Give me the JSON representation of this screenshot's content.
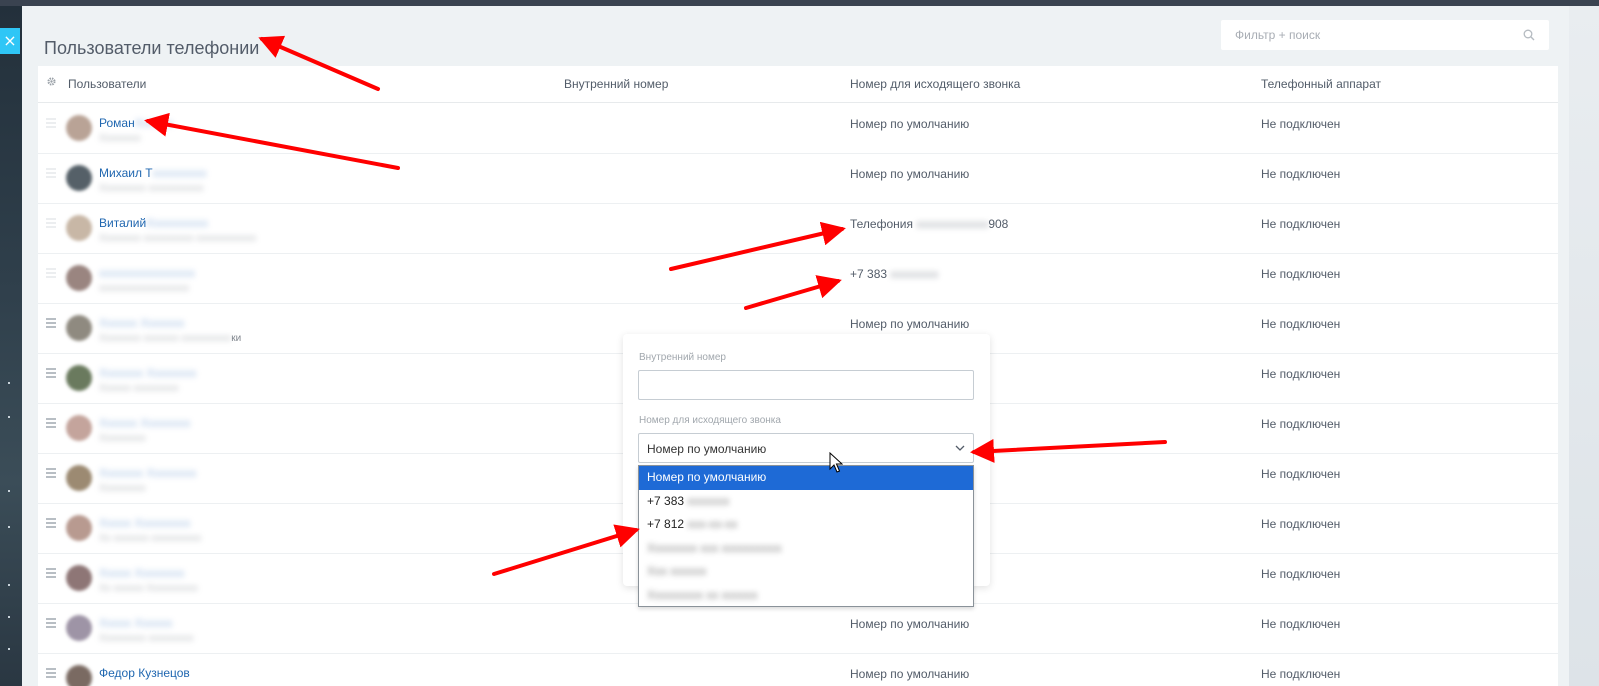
{
  "page": {
    "title": "Пользователи телефонии",
    "search_placeholder": "Фильтр + поиск",
    "close_symbol": "×"
  },
  "table": {
    "columns": [
      "Пользователи",
      "Внутренний номер",
      "Номер для исходящего звонка",
      "Телефонный аппарат"
    ],
    "rows": [
      {
        "name": "Роман",
        "name_blur": "Xxxxxx",
        "sub": "Xxxxxxxx",
        "outgoing": "Номер по умолчанию",
        "outgoing_blur": "",
        "outgoing_tail": "",
        "device": "Не подключен"
      },
      {
        "name": "Михаил Т",
        "name_blur": "xxxxxxxxx",
        "sub": "Xxxxxxxxx xxxxxxxxxxx",
        "outgoing": "Номер по умолчанию",
        "outgoing_blur": "",
        "outgoing_tail": "",
        "device": "Не подключен"
      },
      {
        "name": "Виталий",
        "name_blur": "Xxxxxxxxxx",
        "sub": "Xxxxxxxx xxxxxxxxxx xxxxxxxxxxxx",
        "outgoing": "Телефония",
        "outgoing_blur": "xxxxxxxxxxxx",
        "outgoing_tail": "908",
        "device": "Не подключен"
      },
      {
        "name": "",
        "name_blur": "xxxxxxxxxxxxxxxx",
        "sub": "xxxxxxxxxxxxxxxxxx",
        "outgoing": "+7 383",
        "outgoing_blur": "xxxxxxxx",
        "outgoing_tail": "",
        "device": "Не подключен"
      },
      {
        "name": "",
        "name_blur": "Xxxxxx Xxxxxxx",
        "sub": "Xxxxxxxx xxxxxxx xxxxxxxxxx",
        "sub_visible": "ки",
        "outgoing": "Номер по умолчанию",
        "outgoing_blur": "",
        "outgoing_tail": "",
        "device": "Не подключен"
      },
      {
        "name": "",
        "name_blur": "Xxxxxxx Xxxxxxxx",
        "sub": "Xxxxxx xxxxxxxxx",
        "outgoing": "",
        "outgoing_blur": "",
        "outgoing_tail": "",
        "device": "Не подключен"
      },
      {
        "name": "",
        "name_blur": "Xxxxxx Xxxxxxxx",
        "sub": "Xxxxxxxxx",
        "outgoing": "",
        "outgoing_blur": "",
        "outgoing_tail": "",
        "device": "Не подключен"
      },
      {
        "name": "",
        "name_blur": "Xxxxxxx Xxxxxxxx",
        "sub": "Xxxxxxxxx",
        "outgoing": "",
        "outgoing_blur": "",
        "outgoing_tail": "",
        "device": "Не подключен"
      },
      {
        "name": "",
        "name_blur": "Xxxxx Xxxxxxxxx",
        "sub": "Xx xxxxxxx xxxxxxxxxx",
        "outgoing": "",
        "outgoing_blur": "",
        "outgoing_tail": "",
        "device": "Не подключен"
      },
      {
        "name": "",
        "name_blur": "Xxxxx Xxxxxxxx",
        "sub": "Xx xxxxxx Xxxxxxxxxx",
        "outgoing": "",
        "outgoing_blur": "",
        "outgoing_tail": "",
        "device": "Не подключен"
      },
      {
        "name": "",
        "name_blur": "Xxxxx Xxxxxx",
        "sub": "Xxxxxxxxx xxxxxxxxx",
        "outgoing": "Номер по умолчанию",
        "outgoing_blur": "",
        "outgoing_tail": "",
        "device": "Не подключен"
      },
      {
        "name": "Федор Кузнецов",
        "name_blur": "",
        "sub": "",
        "outgoing": "Номер по умолчанию",
        "outgoing_blur": "",
        "outgoing_tail": "",
        "device": "Не подключен"
      }
    ]
  },
  "popup": {
    "internal_label": "Внутренний номер",
    "internal_value": "",
    "outgoing_label": "Номер для исходящего звонка",
    "outgoing_selected": "Номер по умолчанию",
    "options": [
      {
        "label": "Номер по умолчанию",
        "blur": ""
      },
      {
        "label": "+7 383",
        "blur": "xxxxxxx"
      },
      {
        "label": "+7 812",
        "blur": "xxx-xx-xx"
      },
      {
        "label": "",
        "blur": "Xxxxxxxx xxx xxxxxxxxxx"
      },
      {
        "label": "",
        "blur": "Xxx xxxxxx"
      },
      {
        "label": "",
        "blur": "Xxxxxxxxx xx xxxxxx"
      }
    ]
  },
  "colors": {
    "accent": "#2fc6f6",
    "link": "#2067b0",
    "selection": "#1e6ad6",
    "annotation_arrow": "#ff0000"
  }
}
